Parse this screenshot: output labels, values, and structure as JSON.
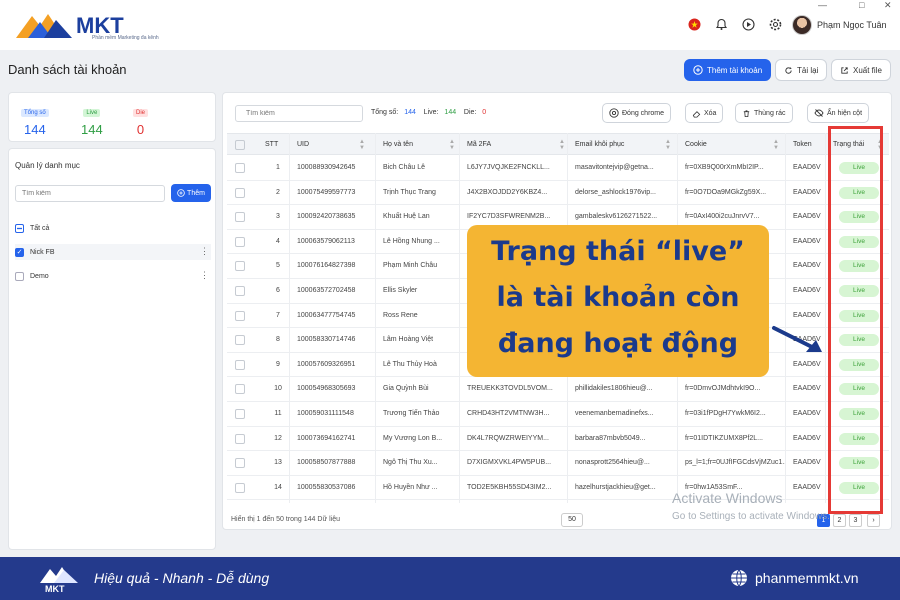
{
  "app": {
    "logo_text": "MKT",
    "logo_sub": "Phần mềm Marketing đa kênh",
    "username": "Phạm Ngọc Tuân",
    "window_controls": [
      "—",
      "□",
      "✕"
    ]
  },
  "page": {
    "title": "Danh sách tài khoản",
    "buttons": {
      "add_account": "Thêm tài khoản",
      "reload": "Tải lại",
      "export": "Xuất file"
    }
  },
  "stats": [
    {
      "label": "Tổng số",
      "value": "144",
      "color": "#2563eb",
      "bg": "#dbe8ff"
    },
    {
      "label": "Live",
      "value": "144",
      "color": "#2f9e44",
      "bg": "#d3f5d6"
    },
    {
      "label": "Die",
      "value": "0",
      "color": "#e03131",
      "bg": "#ffe0e0"
    }
  ],
  "categories": {
    "title": "Quản lý danh mục",
    "search_placeholder": "Tìm kiếm",
    "add_label": "Thêm",
    "items": [
      {
        "label": "Tất cả",
        "state": "minus"
      },
      {
        "label": "Nick FB",
        "state": "checked"
      },
      {
        "label": "Demo",
        "state": "unchecked"
      }
    ]
  },
  "table": {
    "search_placeholder": "Tìm kiếm",
    "summary": {
      "total_label": "Tổng số:",
      "total": "144",
      "live_label": "Live:",
      "live": "144",
      "die_label": "Die:",
      "die": "0"
    },
    "toolbar": {
      "chrome": "Đóng chrome",
      "delete": "Xóa",
      "trash": "Thùng rác",
      "toggle_cols": "Ẩn hiện cột"
    },
    "columns": [
      "STT",
      "UID",
      "Họ và tên",
      "Mã 2FA",
      "Email khôi phục",
      "Cookie",
      "Token",
      "Trạng thái"
    ],
    "rows": [
      [
        "1",
        "100088930942645",
        "Bich Châu Lê",
        "L6JY7JVQJKE2FNCKLL...",
        "masavitontejvip@getna...",
        "fr=0XB9Q00rXmMbI2IP...",
        "EAAD6V",
        "Live"
      ],
      [
        "2",
        "100075499597773",
        "Trịnh Thục Trang",
        "J4X2BXOJDD2Y6KBZ4...",
        "delorse_ashlock1976vip...",
        "fr=0O7DOa9MGkZg59X...",
        "EAAD6V",
        "Live"
      ],
      [
        "3",
        "100092420738635",
        "Khuất Huệ Lan",
        "IF2YC7D3SFWRENM2B...",
        "gambaleskv6126271522...",
        "fr=0AxI400i2cuJnrvV7...",
        "EAAD6V",
        "Live"
      ],
      [
        "4",
        "100063579062113",
        "Lê Hồng Nhung ...",
        "",
        "",
        "",
        "EAAD6V",
        "Live"
      ],
      [
        "5",
        "100076164827398",
        "Phạm Minh Châu",
        "",
        "",
        "",
        "EAAD6V",
        "Live"
      ],
      [
        "6",
        "100063572702458",
        "Ellis Skyler",
        "",
        "",
        "",
        "EAAD6V",
        "Live"
      ],
      [
        "7",
        "100063477754745",
        "Ross Rene",
        "",
        "",
        "",
        "EAAD6V",
        "Live"
      ],
      [
        "8",
        "100058330714746",
        "Lâm Hoàng Việt",
        "",
        "",
        "",
        "EAAD6V",
        "Live"
      ],
      [
        "9",
        "100057609326951",
        "Lê Thu Thủy Hoà",
        "",
        "",
        "",
        "EAAD6V",
        "Live"
      ],
      [
        "10",
        "100054968305693",
        "Gia Quỳnh Bùi",
        "TREUEKK3TOVDL5VOM...",
        "phillidakiles1806hieu@...",
        "fr=0DmvOJMdhtvkI9O...",
        "EAAD6V",
        "Live"
      ],
      [
        "11",
        "100059031111548",
        "Trương Tiến Thảo",
        "CRHD43HT2VMTNW3H...",
        "veenemanbernadinefxs...",
        "fr=03i1fPDgH7YwkM6I2...",
        "EAAD6V",
        "Live"
      ],
      [
        "12",
        "100073694162741",
        "My Vương Lon B...",
        "DK4L7RQWZRWEIYYM...",
        "barbara87mbvb5049...",
        "fr=01IDTIKZUMX8Pf2L...",
        "EAAD6V",
        "Live"
      ],
      [
        "13",
        "100058507877888",
        "Ngô Thị Thu Xu...",
        "D7XIGMXVKL4PW5PUB...",
        "nonasprott2564hieu@...",
        "ps_l=1;fr=0UJfIFGCdsVjMZuc1...",
        "EAAD6V",
        "Live"
      ],
      [
        "14",
        "100055830537086",
        "Hồ Huyền Như ...",
        "TOD2E5KBH55SD43IM2...",
        "hazelhurstjackhieu@get...",
        "fr=0hw1A53SmF...",
        "EAAD6V",
        "Live"
      ]
    ],
    "footer": {
      "showing": "Hiển thị 1 đến 50 trong 144 Dữ liệu",
      "page_size": "50",
      "pages": [
        "1",
        "2",
        "3",
        "›"
      ]
    }
  },
  "watermark": {
    "line1": "Activate Windows",
    "line2": "Go to Settings to activate Windows."
  },
  "callout": {
    "lines": [
      "Trạng thái “live”",
      "là tài khoản còn",
      "đang hoạt động"
    ],
    "bg": "#f4b533",
    "text_color": "#1b3a8c",
    "highlight_color": "#e53935"
  },
  "banner": {
    "tagline": "Hiệu quả - Nhanh - Dễ dùng",
    "website": "phanmemmkt.vn",
    "bg": "#243a8c"
  }
}
